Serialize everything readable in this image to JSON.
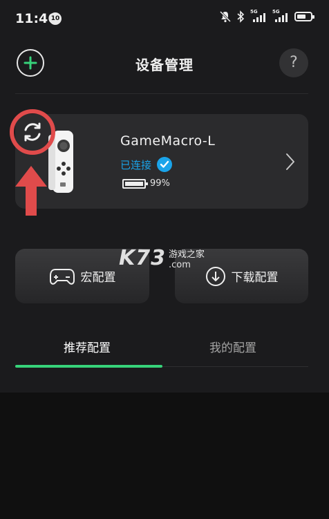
{
  "status_bar": {
    "time": "11:46",
    "notif_badge": "10",
    "sim1_label": "5G",
    "sim2_label": "5G"
  },
  "header": {
    "title": "设备管理",
    "help_label": "?"
  },
  "device": {
    "name": "GameMacro-L",
    "status": "已连接",
    "battery_text": "99%",
    "battery_level": 0.99
  },
  "actions": {
    "macro_label": "宏配置",
    "download_label": "下载配置"
  },
  "watermark": {
    "big": "K73",
    "top": "游戏之家",
    "bottom": ".com"
  },
  "tabs": [
    {
      "label": "推荐配置",
      "active": true
    },
    {
      "label": "我的配置",
      "active": false
    }
  ],
  "colors": {
    "accent_green": "#37d37a",
    "status_blue": "#1aa4ea",
    "annotation_red": "#e04b4b"
  }
}
